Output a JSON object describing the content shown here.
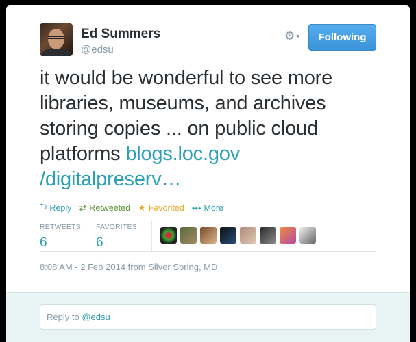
{
  "author": {
    "name": "Ed Summers",
    "handle": "@edsu"
  },
  "header": {
    "follow_label": "Following",
    "menu_icon": "gear-icon"
  },
  "tweet": {
    "text": "it would be wonderful to see more libraries, museums, and archives storing copies ... on public cloud platforms ",
    "link_part1": "blogs.loc.gov",
    "link_part2": "/digitalpreserv…"
  },
  "actions": {
    "reply": "Reply",
    "retweeted": "Retweeted",
    "favorited": "Favorited",
    "more": "More"
  },
  "stats": {
    "retweets_label": "RETWEETS",
    "retweets_count": "6",
    "favorites_label": "FAVORITES",
    "favorites_count": "6"
  },
  "timestamp": "8:08 AM - 2 Feb 2014 from Silver Spring, MD",
  "reply": {
    "prefix": "Reply to ",
    "mention": "@edsu"
  },
  "colors": {
    "accent": "#2aa0b4",
    "retweet": "#5c913b",
    "favorite": "#e7a823",
    "follow_button": "#55acee"
  }
}
